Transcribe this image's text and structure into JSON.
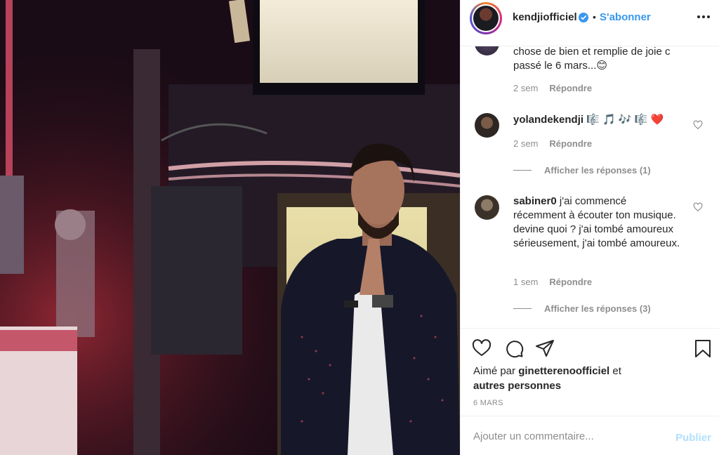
{
  "header": {
    "username": "kendjiofficiel",
    "dot": "•",
    "follow_label": "S'abonner",
    "verified_icon": "verified-badge-icon",
    "more_icon": "more-options-icon"
  },
  "comments": [
    {
      "username": "",
      "text_lines": [
        "chose de bien et remplie de joie c",
        "passé le 6 mars...😊"
      ],
      "time": "2 sem",
      "reply_label": "Répondre"
    },
    {
      "username": "yolandekendji",
      "text": "🎼 🎵 🎶 🎼 ❤️",
      "time": "2 sem",
      "reply_label": "Répondre",
      "view_replies": "Afficher les réponses (1)"
    },
    {
      "username": "sabiner0",
      "text": "j'ai commencé récemment à écouter ton musique. devine quoi ? j'ai tombé amoureux sérieusement, j'ai tombé amoureux.",
      "time": "1 sem",
      "reply_label": "Répondre",
      "view_replies": "Afficher les réponses (3)"
    }
  ],
  "actions": {
    "like_icon": "heart-icon",
    "comment_icon": "comment-icon",
    "share_icon": "share-icon",
    "save_icon": "bookmark-icon",
    "liked_by_prefix": "Aimé par",
    "liked_by_user": "ginetterenoofficiel",
    "liked_by_and": "et",
    "liked_by_others": "autres personnes",
    "date": "6 MARS"
  },
  "comment_box": {
    "placeholder": "Ajouter un commentaire...",
    "post_label": "Publier"
  },
  "colors": {
    "accent": "#3897f0",
    "post_disabled": "#b2dffc",
    "secondary_text": "#8e8e8e"
  }
}
